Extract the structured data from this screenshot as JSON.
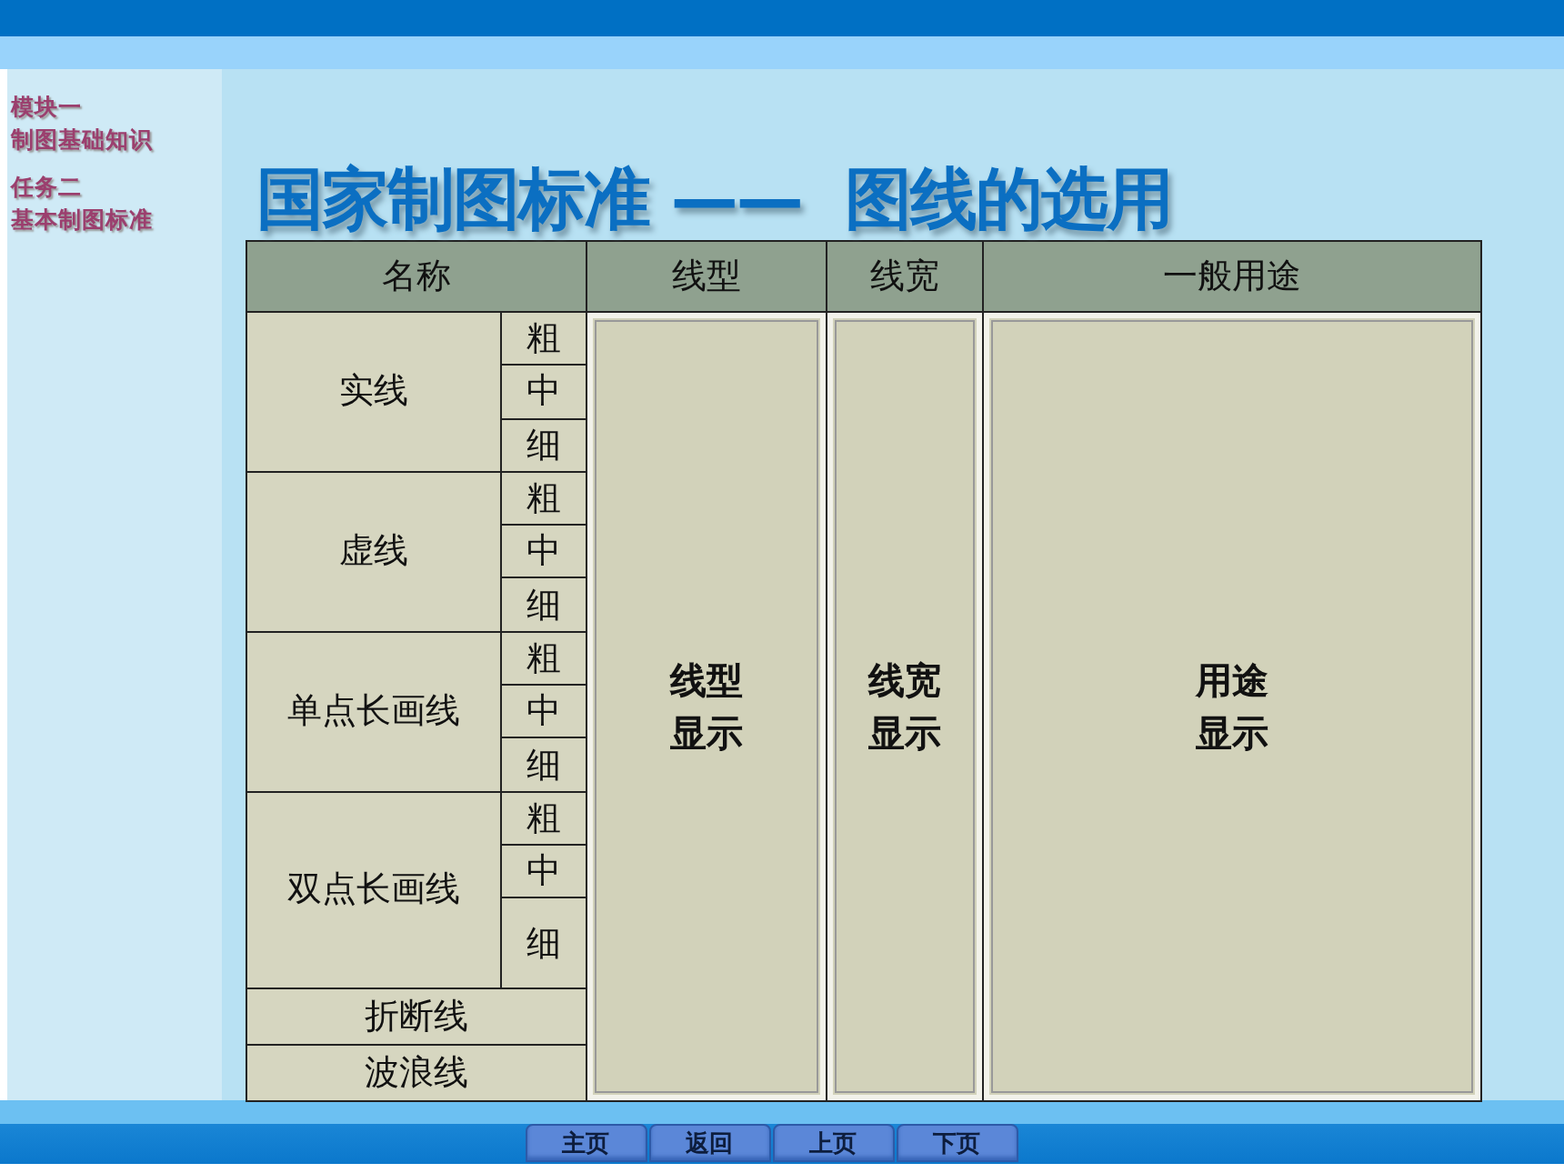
{
  "sidebar": {
    "module": "模块一",
    "module_title": "制图基础知识",
    "task": "任务二",
    "task_title": "基本制图标准"
  },
  "title": "国家制图标准 ——  图线的选用",
  "table": {
    "columns": [
      "名称",
      "线型",
      "线宽",
      "一般用途"
    ],
    "groups": [
      {
        "name": "实线",
        "widths": [
          "粗",
          "中",
          "细"
        ]
      },
      {
        "name": "虚线",
        "widths": [
          "粗",
          "中",
          "细"
        ]
      },
      {
        "name": "单点长画线",
        "widths": [
          "粗",
          "中",
          "细"
        ]
      },
      {
        "name": "双点长画线",
        "widths": [
          "粗",
          "中",
          "细"
        ]
      }
    ],
    "single_rows": [
      "折断线",
      "波浪线"
    ],
    "displays": [
      "线型显示",
      "线宽显示",
      "用途显示"
    ]
  },
  "nav_buttons": [
    "主页",
    "返回",
    "上页",
    "下页"
  ]
}
